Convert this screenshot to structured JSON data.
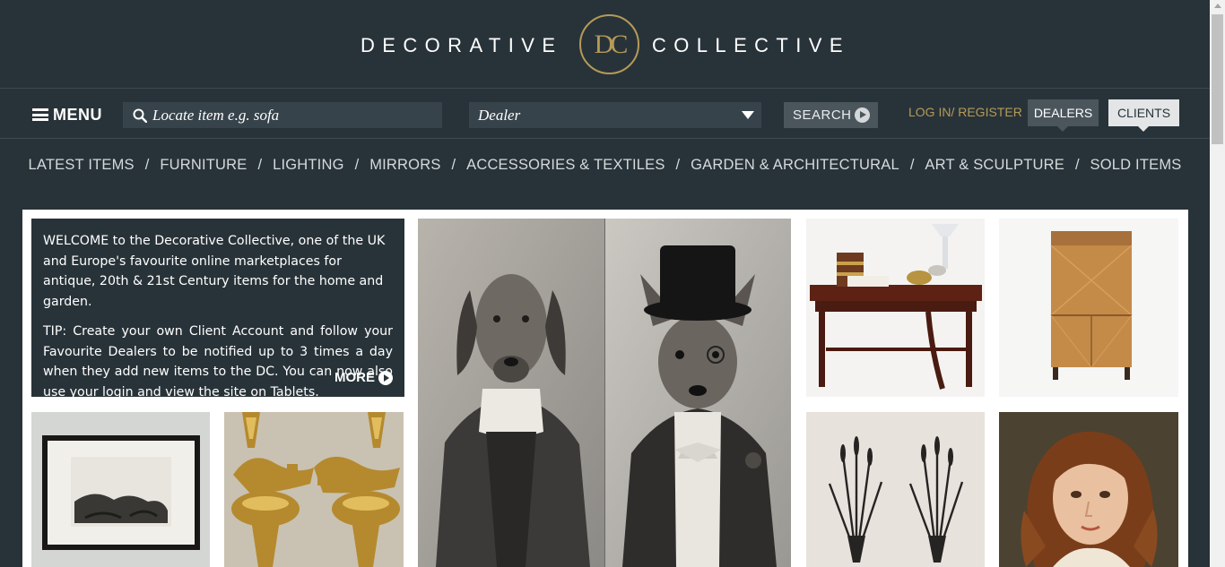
{
  "brand": {
    "left_word": "DECORATIVE",
    "monogram": "DC",
    "right_word": "COLLECTIVE"
  },
  "toolbar": {
    "menu_label": "MENU",
    "search_placeholder": "Locate item e.g. sofa",
    "dealer_select": "Dealer",
    "search_button": "SEARCH",
    "login_link": "LOG IN/ REGISTER",
    "dealers_button": "DEALERS",
    "clients_button": "CLIENTS"
  },
  "categories": [
    "LATEST ITEMS",
    "FURNITURE",
    "LIGHTING",
    "MIRRORS",
    "ACCESSORIES & TEXTILES",
    "GARDEN & ARCHITECTURAL",
    "ART & SCULPTURE",
    "SOLD ITEMS"
  ],
  "category_separator": "/",
  "welcome": {
    "intro": "WELCOME to the Decorative Collective, one of the UK and Europe's favourite online marketplaces for antique, 20th & 21st Century items for the home and garden.",
    "tip": "TIP: Create your own Client Account and follow your Favourite Dealers to be notified up to 3 times a day when they add new items to the DC.  You can now also use your login and view the site on Tablets.",
    "more_label": "MORE"
  },
  "colors": {
    "header_bg": "#283339",
    "accent_gold": "#b59a58",
    "input_bg": "#37434a",
    "button_bg": "#4b565c",
    "clients_bg": "#e3e5e6"
  }
}
